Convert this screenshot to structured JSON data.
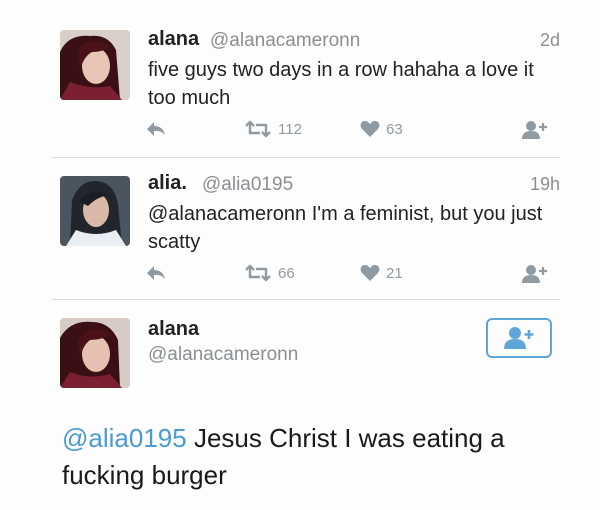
{
  "tweets": [
    {
      "name": "alana",
      "handle": "@alanacameronn",
      "time": "2d",
      "text": "five guys two days in a row hahaha a love it too much",
      "retweets": "112",
      "likes": "63"
    },
    {
      "name": "alia.",
      "handle": "@alia0195",
      "time": "19h",
      "text": "@alanacameronn I'm a feminist, but you just scatty",
      "retweets": "66",
      "likes": "21"
    }
  ],
  "detail": {
    "name": "alana",
    "handle": "@alanacameronn",
    "mention": "@alia0195",
    "text": " Jesus Christ I was eating a fucking burger"
  },
  "icons": {
    "reply": "reply-icon",
    "retweet": "retweet-icon",
    "like": "heart-icon",
    "follow": "follow-user-icon"
  },
  "colors": {
    "accent": "#5fa6d8",
    "mention": "#4a9bd1",
    "muted": "#8f9aa3"
  }
}
